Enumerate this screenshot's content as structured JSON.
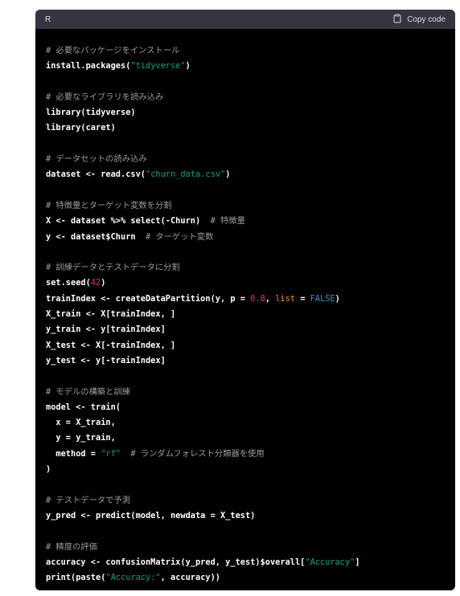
{
  "header": {
    "language": "R",
    "copy_label": "Copy code",
    "copy_icon": "clipboard-icon"
  },
  "colors": {
    "background": "#000000",
    "header_bg": "#343541",
    "comment": "#9b9b9b",
    "string": "#00a67d",
    "number": "#df3079",
    "builtin": "#e9950c",
    "literal": "#2e95d3"
  },
  "code_lines": [
    [
      {
        "t": "comment",
        "v": "# 必要なパッケージをインストール"
      }
    ],
    [
      {
        "t": "code",
        "v": "install.packages("
      },
      {
        "t": "string",
        "v": "\"tidyverse\""
      },
      {
        "t": "code",
        "v": ")"
      }
    ],
    [],
    [
      {
        "t": "comment",
        "v": "# 必要なライブラリを読み込み"
      }
    ],
    [
      {
        "t": "code",
        "v": "library(tidyverse)"
      }
    ],
    [
      {
        "t": "code",
        "v": "library(caret)"
      }
    ],
    [],
    [
      {
        "t": "comment",
        "v": "# データセットの読み込み"
      }
    ],
    [
      {
        "t": "code",
        "v": "dataset <- read.csv("
      },
      {
        "t": "string",
        "v": "\"churn_data.csv\""
      },
      {
        "t": "code",
        "v": ")"
      }
    ],
    [],
    [
      {
        "t": "comment",
        "v": "# 特徴量とターゲット変数を分割"
      }
    ],
    [
      {
        "t": "code",
        "v": "X <- dataset %>% select(-Churn)  "
      },
      {
        "t": "comment",
        "v": "# 特徴量"
      }
    ],
    [
      {
        "t": "code",
        "v": "y <- dataset$Churn  "
      },
      {
        "t": "comment",
        "v": "# ターゲット変数"
      }
    ],
    [],
    [
      {
        "t": "comment",
        "v": "# 訓練データとテストデータに分割"
      }
    ],
    [
      {
        "t": "code",
        "v": "set.seed("
      },
      {
        "t": "number",
        "v": "42"
      },
      {
        "t": "code",
        "v": ")"
      }
    ],
    [
      {
        "t": "code",
        "v": "trainIndex <- createDataPartition(y, p = "
      },
      {
        "t": "number",
        "v": "0.8"
      },
      {
        "t": "code",
        "v": ", "
      },
      {
        "t": "builtin",
        "v": "list"
      },
      {
        "t": "code",
        "v": " = "
      },
      {
        "t": "literal",
        "v": "FALSE"
      },
      {
        "t": "code",
        "v": ")"
      }
    ],
    [
      {
        "t": "code",
        "v": "X_train <- X[trainIndex, ]"
      }
    ],
    [
      {
        "t": "code",
        "v": "y_train <- y[trainIndex]"
      }
    ],
    [
      {
        "t": "code",
        "v": "X_test <- X[-trainIndex, ]"
      }
    ],
    [
      {
        "t": "code",
        "v": "y_test <- y[-trainIndex]"
      }
    ],
    [],
    [
      {
        "t": "comment",
        "v": "# モデルの構築と訓練"
      }
    ],
    [
      {
        "t": "code",
        "v": "model <- train("
      }
    ],
    [
      {
        "t": "code",
        "v": "  x = X_train,"
      }
    ],
    [
      {
        "t": "code",
        "v": "  y = y_train,"
      }
    ],
    [
      {
        "t": "code",
        "v": "  method = "
      },
      {
        "t": "string",
        "v": "\"rf\""
      },
      {
        "t": "code",
        "v": "  "
      },
      {
        "t": "comment",
        "v": "# ランダムフォレスト分類器を使用"
      }
    ],
    [
      {
        "t": "code",
        "v": ")"
      }
    ],
    [],
    [
      {
        "t": "comment",
        "v": "# テストデータで予測"
      }
    ],
    [
      {
        "t": "code",
        "v": "y_pred <- predict(model, newdata = X_test)"
      }
    ],
    [],
    [
      {
        "t": "comment",
        "v": "# 精度の評価"
      }
    ],
    [
      {
        "t": "code",
        "v": "accuracy <- confusionMatrix(y_pred, y_test)$overall["
      },
      {
        "t": "string",
        "v": "\"Accuracy\""
      },
      {
        "t": "code",
        "v": "]"
      }
    ],
    [
      {
        "t": "code",
        "v": "print(paste("
      },
      {
        "t": "string",
        "v": "\"Accuracy:\""
      },
      {
        "t": "code",
        "v": ", accuracy))"
      }
    ]
  ]
}
